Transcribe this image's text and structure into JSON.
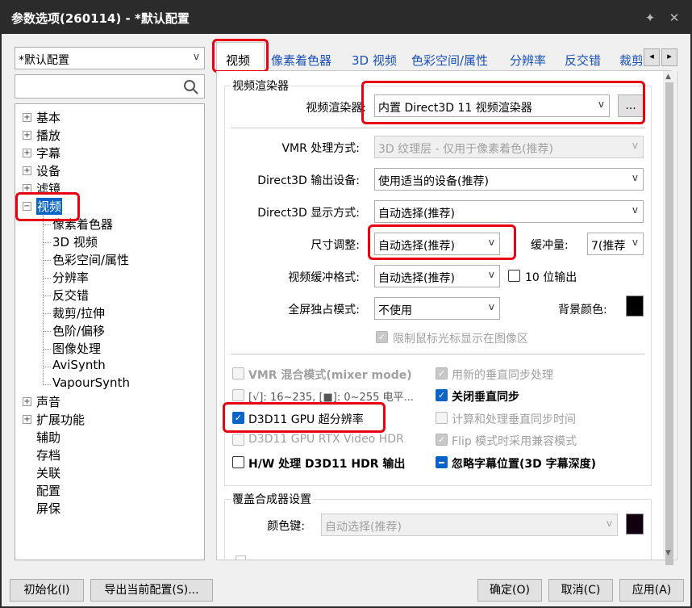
{
  "window": {
    "title": "参数选项(260114) - *默认配置",
    "pin_icon": "pin-icon",
    "close_icon": "close-icon"
  },
  "profile": {
    "value": "*默认配置"
  },
  "search": {
    "placeholder": "",
    "icon": "search-icon"
  },
  "tree": {
    "items": [
      {
        "label": "基本",
        "expander": "⊞"
      },
      {
        "label": "播放",
        "expander": "⊞"
      },
      {
        "label": "字幕",
        "expander": "⊞"
      },
      {
        "label": "设备",
        "expander": "⊞"
      },
      {
        "label": "滤镜",
        "expander": "⊞"
      },
      {
        "label": "视频",
        "expander": "⊟"
      },
      {
        "label": "像素着色器"
      },
      {
        "label": "3D 视频"
      },
      {
        "label": "色彩空间/属性"
      },
      {
        "label": "分辨率"
      },
      {
        "label": "反交错"
      },
      {
        "label": "裁剪/拉伸"
      },
      {
        "label": "色阶/偏移"
      },
      {
        "label": "图像处理"
      },
      {
        "label": "AviSynth"
      },
      {
        "label": "VapourSynth"
      },
      {
        "label": "声音",
        "expander": "⊞"
      },
      {
        "label": "扩展功能",
        "expander": "⊞"
      },
      {
        "label": "辅助"
      },
      {
        "label": "存档"
      },
      {
        "label": "关联"
      },
      {
        "label": "配置"
      },
      {
        "label": "屏保"
      }
    ]
  },
  "tabs": [
    "视频",
    "像素着色器",
    "3D 视频",
    "色彩空间/属性",
    "分辨率",
    "反交错",
    "裁剪"
  ],
  "tab_scroll": {
    "left": "◂",
    "right": "▸"
  },
  "renderer_group": {
    "title": "视频渲染器",
    "renderer_label": "视频渲染器:",
    "renderer_value": "内置 Direct3D 11 视频渲染器",
    "more_button": "..."
  },
  "settings": {
    "vmr_label": "VMR 处理方式:",
    "vmr_value": "3D 纹理层 - 仅用于像素着色(推荐)",
    "d3d_device_label": "Direct3D 输出设备:",
    "d3d_device_value": "使用适当的设备(推荐)",
    "d3d_display_label": "Direct3D 显示方式:",
    "d3d_display_value": "自动选择(推荐)",
    "size_label": "尺寸调整:",
    "size_value": "自动选择(推荐)",
    "buffer_label": "缓冲量:",
    "buffer_value": "7(推荐",
    "format_label": "视频缓冲格式:",
    "format_value": "自动选择(推荐)",
    "ten_bit_label": "10 位输出",
    "fullscreen_label": "全屏独占模式:",
    "fullscreen_value": "不使用",
    "bg_color_label": "背景颜色:",
    "limit_cursor_label": "限制鼠标光标显示在图像区"
  },
  "checks": {
    "vmr_mixer": "VMR 混合模式(mixer mode)",
    "new_vsync": "用新的垂直同步处理",
    "levels": "[√]: 16~235, [■]: 0~255 电平...",
    "close_vsync": "关闭垂直同步",
    "d3d11_super_res": "D3D11 GPU 超分辨率",
    "calc_vsync_time": "计算和处理垂直同步时间",
    "rtx_hdr": "D3D11 GPU RTX Video HDR",
    "flip_compat": "Flip 模式时采用兼容模式",
    "hw_hdr": "H/W 处理 D3D11 HDR 输出",
    "ignore_subtitle_pos": "忽略字幕位置(3D 字幕深度)"
  },
  "overlay_group": {
    "title": "覆盖合成器设置",
    "color_key_label": "颜色键:",
    "color_key_value": "自动选择(推荐)"
  },
  "footer": {
    "init": "初始化(I)",
    "export": "导出当前配置(S)...",
    "ok": "确定(O)",
    "cancel": "取消(C)",
    "apply": "应用(A)"
  },
  "colors": {
    "highlight": "#e60012",
    "checkbox": "#0a64c8",
    "link": "#1a50b4"
  }
}
